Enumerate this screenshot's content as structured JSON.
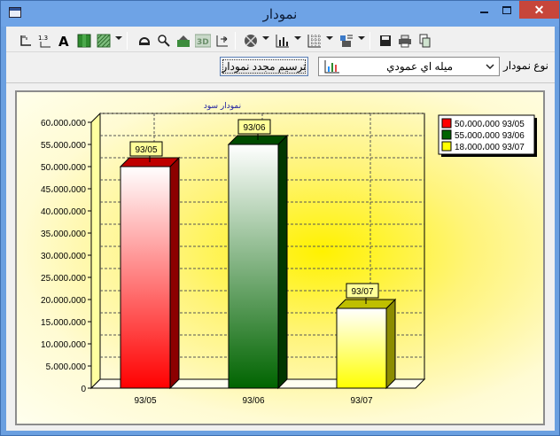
{
  "window": {
    "title": "نمودار",
    "close_glyph": "✕",
    "minimize_icon": "minimize-icon",
    "maximize_icon": "maximize-icon"
  },
  "toolbar": {
    "buttons": [
      "axis-icon",
      "data-labels-icon",
      "font-icon",
      "fill-color-icon",
      "pattern-icon",
      "rotate-icon",
      "zoom-icon",
      "scale-icon",
      "3d-toggle-icon",
      "move-icon",
      "palette-icon",
      "chart-type-icon",
      "grid-icon",
      "series-icon",
      "save-icon",
      "print-icon",
      "copy-icon"
    ],
    "three_d_label": "3D",
    "redraw_button": "ترسیم مجدد نمودار",
    "chart_type_value": "میله اي عمودي",
    "chart_type_label": "نوع نمودار"
  },
  "colors": {
    "bar1": "#ff0000",
    "bar2": "#006400",
    "bar3": "#ffff00",
    "title": "#1a1aa0"
  },
  "chart_data": {
    "type": "bar",
    "title": "نمودار سود",
    "categories": [
      "93/05",
      "93/06",
      "93/07"
    ],
    "values": [
      50000000,
      55000000,
      18000000
    ],
    "data_labels": [
      "93/05",
      "93/06",
      "93/07"
    ],
    "legend": [
      "50،000،000 93/05",
      "55،000،000 93/06",
      "18،000،000 93/07"
    ],
    "legend_position": "top-right",
    "ylim": [
      0,
      60000000
    ],
    "ytick_labels": [
      "0",
      "5،000،000",
      "10،000،000",
      "15،000،000",
      "20،000،000",
      "25،000،000",
      "30،000،000",
      "35،000،000",
      "40،000،000",
      "45،000،000",
      "50،000،000",
      "55،000،000",
      "60،000،000"
    ],
    "grid": true,
    "three_d": true
  }
}
